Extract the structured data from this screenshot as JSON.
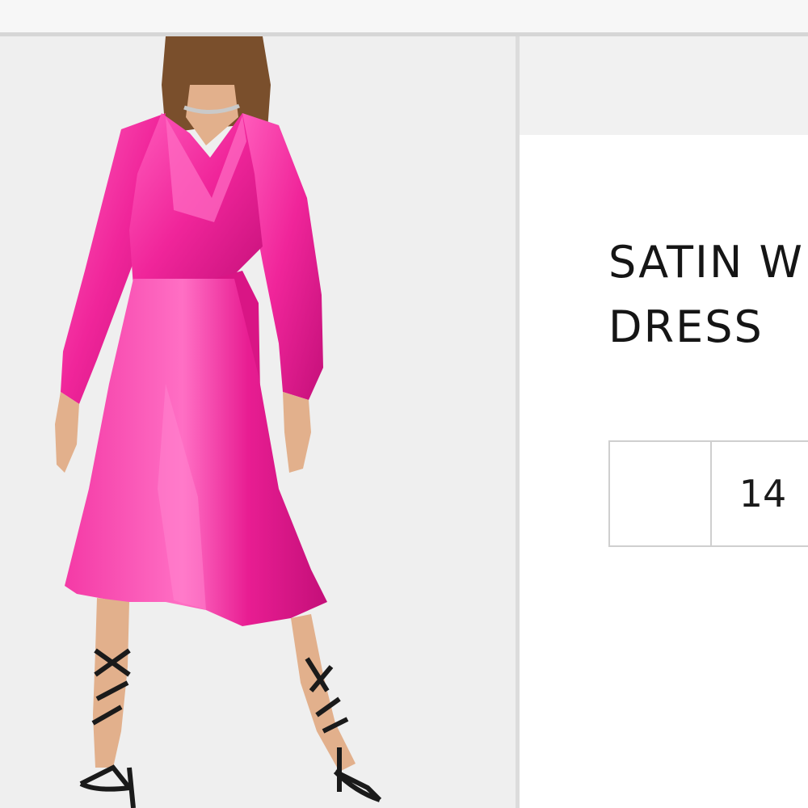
{
  "product": {
    "title": "SATIN W\nDRESS",
    "image_alt": "woman in pink satin wrap midi dress with long balloon sleeves and black strappy sandals"
  },
  "sizes": [
    "",
    "14"
  ],
  "colors": {
    "dress": "#f0259a",
    "dress_shadow": "#c5107a",
    "dress_highlight": "#ff7cc8",
    "skin": "#e2b08c",
    "hair": "#7a4f2c",
    "sandal": "#1a1a1a",
    "background": "#efefef"
  }
}
